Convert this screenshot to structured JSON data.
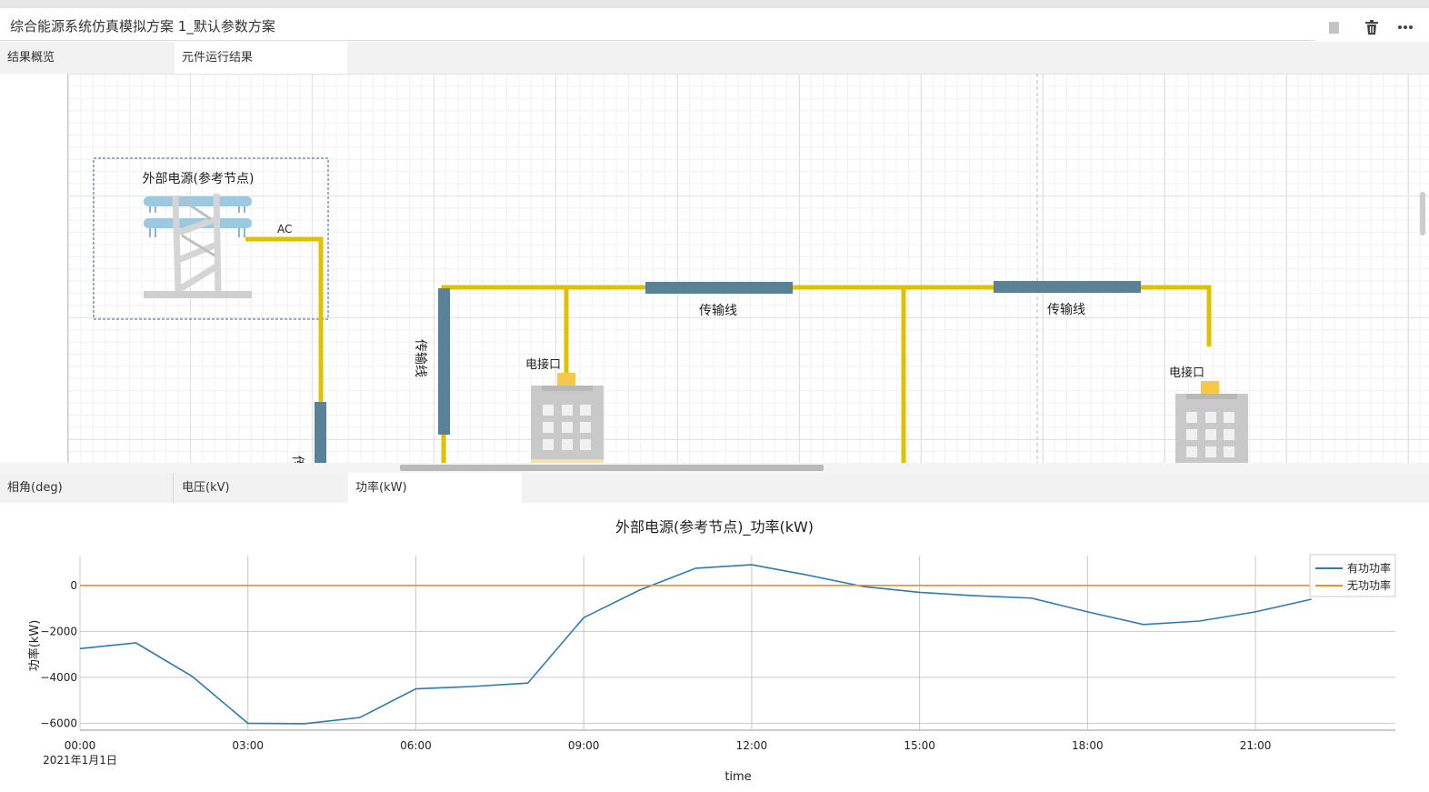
{
  "window": {
    "title": "综合能源系统仿真模拟方案 1_默认参数方案"
  },
  "toolbar": {
    "stop_icon": "square-icon",
    "delete_icon": "trash-icon",
    "more_icon": "more-icon"
  },
  "tabs_top": [
    {
      "label": "结果概览"
    },
    {
      "label": "元件运行结果",
      "active": true
    }
  ],
  "diagram": {
    "source_label": "外部电源(参考节点)",
    "ac_label": "AC",
    "line_labels": [
      "传输线",
      "传输线",
      "传输线",
      "传"
    ],
    "port_labels": [
      "电接口",
      "电接口"
    ],
    "colors": {
      "wire": "#e0c000",
      "line": "#5a8296"
    }
  },
  "tabs_bottom": [
    {
      "label": "相角(deg)"
    },
    {
      "label": "电压(kV)"
    },
    {
      "label": "功率(kW)",
      "active": true
    }
  ],
  "chart_data": {
    "type": "line",
    "title": "外部电源(参考节点)_功率(kW)",
    "xlabel": "time",
    "ylabel": "功率(kW)",
    "x_ticks": [
      "00:00",
      "03:00",
      "06:00",
      "09:00",
      "12:00",
      "15:00",
      "18:00",
      "21:00"
    ],
    "x_date_label": "2021年1月1日",
    "y_ticks": [
      "0",
      "−2000",
      "−4000",
      "−6000"
    ],
    "x_hours": [
      0,
      1,
      2,
      3,
      4,
      5,
      6,
      7,
      8,
      9,
      10,
      11,
      12,
      13,
      14,
      15,
      16,
      17,
      18,
      19,
      20,
      21,
      22
    ],
    "series": [
      {
        "name": "有功功率",
        "color": "#2e7bad",
        "values": [
          -2750,
          -2500,
          -3950,
          -6000,
          -6020,
          -5750,
          -4500,
          -4400,
          -4250,
          -1400,
          -200,
          750,
          900,
          450,
          -50,
          -300,
          -450,
          -550,
          -1150,
          -1700,
          -1550,
          -1150,
          -600
        ]
      },
      {
        "name": "无功功率",
        "color": "#f28c1c",
        "values": [
          0,
          0,
          0,
          0,
          0,
          0,
          0,
          0,
          0,
          0,
          0,
          0,
          0,
          0,
          0,
          0,
          0,
          0,
          0,
          0,
          0,
          0,
          0
        ]
      }
    ],
    "ylim": [
      -6300,
      1300
    ],
    "xlim": [
      0,
      23.5
    ],
    "legend_position": "top-right",
    "grid": true
  }
}
